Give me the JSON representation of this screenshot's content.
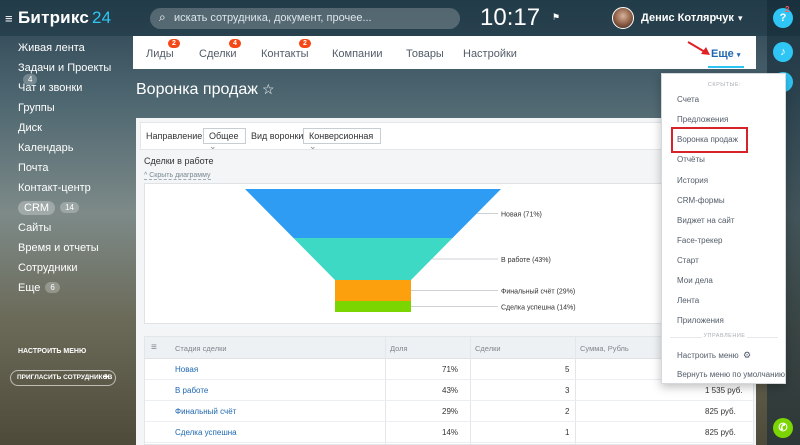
{
  "header": {
    "menu_icon": "hamburger-icon",
    "logo_text": "Битрикс",
    "logo_num": "24",
    "search_placeholder": "искать сотрудника, документ, прочее...",
    "time": "10:17",
    "user_name": "Денис Котлярчук",
    "user_caret": "▾"
  },
  "sidebar": {
    "items": [
      {
        "label": "Живая лента"
      },
      {
        "label": "Задачи и Проекты",
        "count": "4"
      },
      {
        "label": "Чат и звонки"
      },
      {
        "label": "Группы"
      },
      {
        "label": "Диск"
      },
      {
        "label": "Календарь"
      },
      {
        "label": "Почта"
      },
      {
        "label": "Контакт-центр"
      },
      {
        "label": "CRM",
        "count": "14"
      },
      {
        "label": "Сайты"
      },
      {
        "label": "Время и отчеты"
      },
      {
        "label": "Сотрудники"
      },
      {
        "label": "Еще",
        "count": "6"
      }
    ],
    "configure": "НАСТРОИТЬ МЕНЮ",
    "invite": "ПРИГЛАСИТЬ СОТРУДНИКОВ",
    "invite_plus": "+"
  },
  "tabs": [
    {
      "label": "Лиды",
      "badge": "2"
    },
    {
      "label": "Сделки",
      "badge": "4"
    },
    {
      "label": "Контакты",
      "badge": "2"
    },
    {
      "label": "Компании"
    },
    {
      "label": "Товары"
    },
    {
      "label": "Настройки"
    }
  ],
  "more": {
    "label": "Еще",
    "caret": "▾"
  },
  "page": {
    "title": "Воронка продаж",
    "star": "☆"
  },
  "filters": {
    "direction_label": "Направление:",
    "direction_value": "Общее",
    "funnel_label": "Вид воронки:",
    "funnel_value": "Конверсионная",
    "caret": "⌄"
  },
  "chart": {
    "header": "Сделки в работе",
    "hide_link": "^ Скрыть диаграмму"
  },
  "chart_data": {
    "type": "funnel",
    "stages": [
      {
        "label": "Новая (71%)",
        "value": 71,
        "color": "#2e9cf2"
      },
      {
        "label": "В работе (43%)",
        "value": 43,
        "color": "#3dd9c5"
      },
      {
        "label": "Финальный счёт (29%)",
        "value": 29,
        "color": "#fca10d"
      },
      {
        "label": "Сделка успешна (14%)",
        "value": 14,
        "color": "#7bd500"
      }
    ]
  },
  "table": {
    "headers": [
      "Стадия сделки",
      "Доля",
      "Сделки",
      "Сумма, Рубль"
    ],
    "rows": [
      {
        "stage": "Новая",
        "share": "71%",
        "deals": "5",
        "sum": ""
      },
      {
        "stage": "В работе",
        "share": "43%",
        "deals": "3",
        "sum": "1 535 руб."
      },
      {
        "stage": "Финальный счёт",
        "share": "29%",
        "deals": "2",
        "sum": "825 руб."
      },
      {
        "stage": "Сделка успешна",
        "share": "14%",
        "deals": "1",
        "sum": "825 руб."
      }
    ]
  },
  "dropdown": {
    "hidden_label": "СКРЫТЫЕ:",
    "items": [
      "Счета",
      "Предложения",
      "Воронка продаж",
      "Отчёты",
      "История",
      "CRM-формы",
      "Виджет на сайт",
      "Face-трекер",
      "Старт",
      "Мои дела",
      "Лента",
      "Приложения"
    ],
    "manage_label": "УПРАВЛЕНИЕ",
    "configure": "Настроить меню",
    "reset": "Вернуть меню по умолчанию"
  },
  "rightbar": {
    "help": "?",
    "help_badge": "2"
  }
}
